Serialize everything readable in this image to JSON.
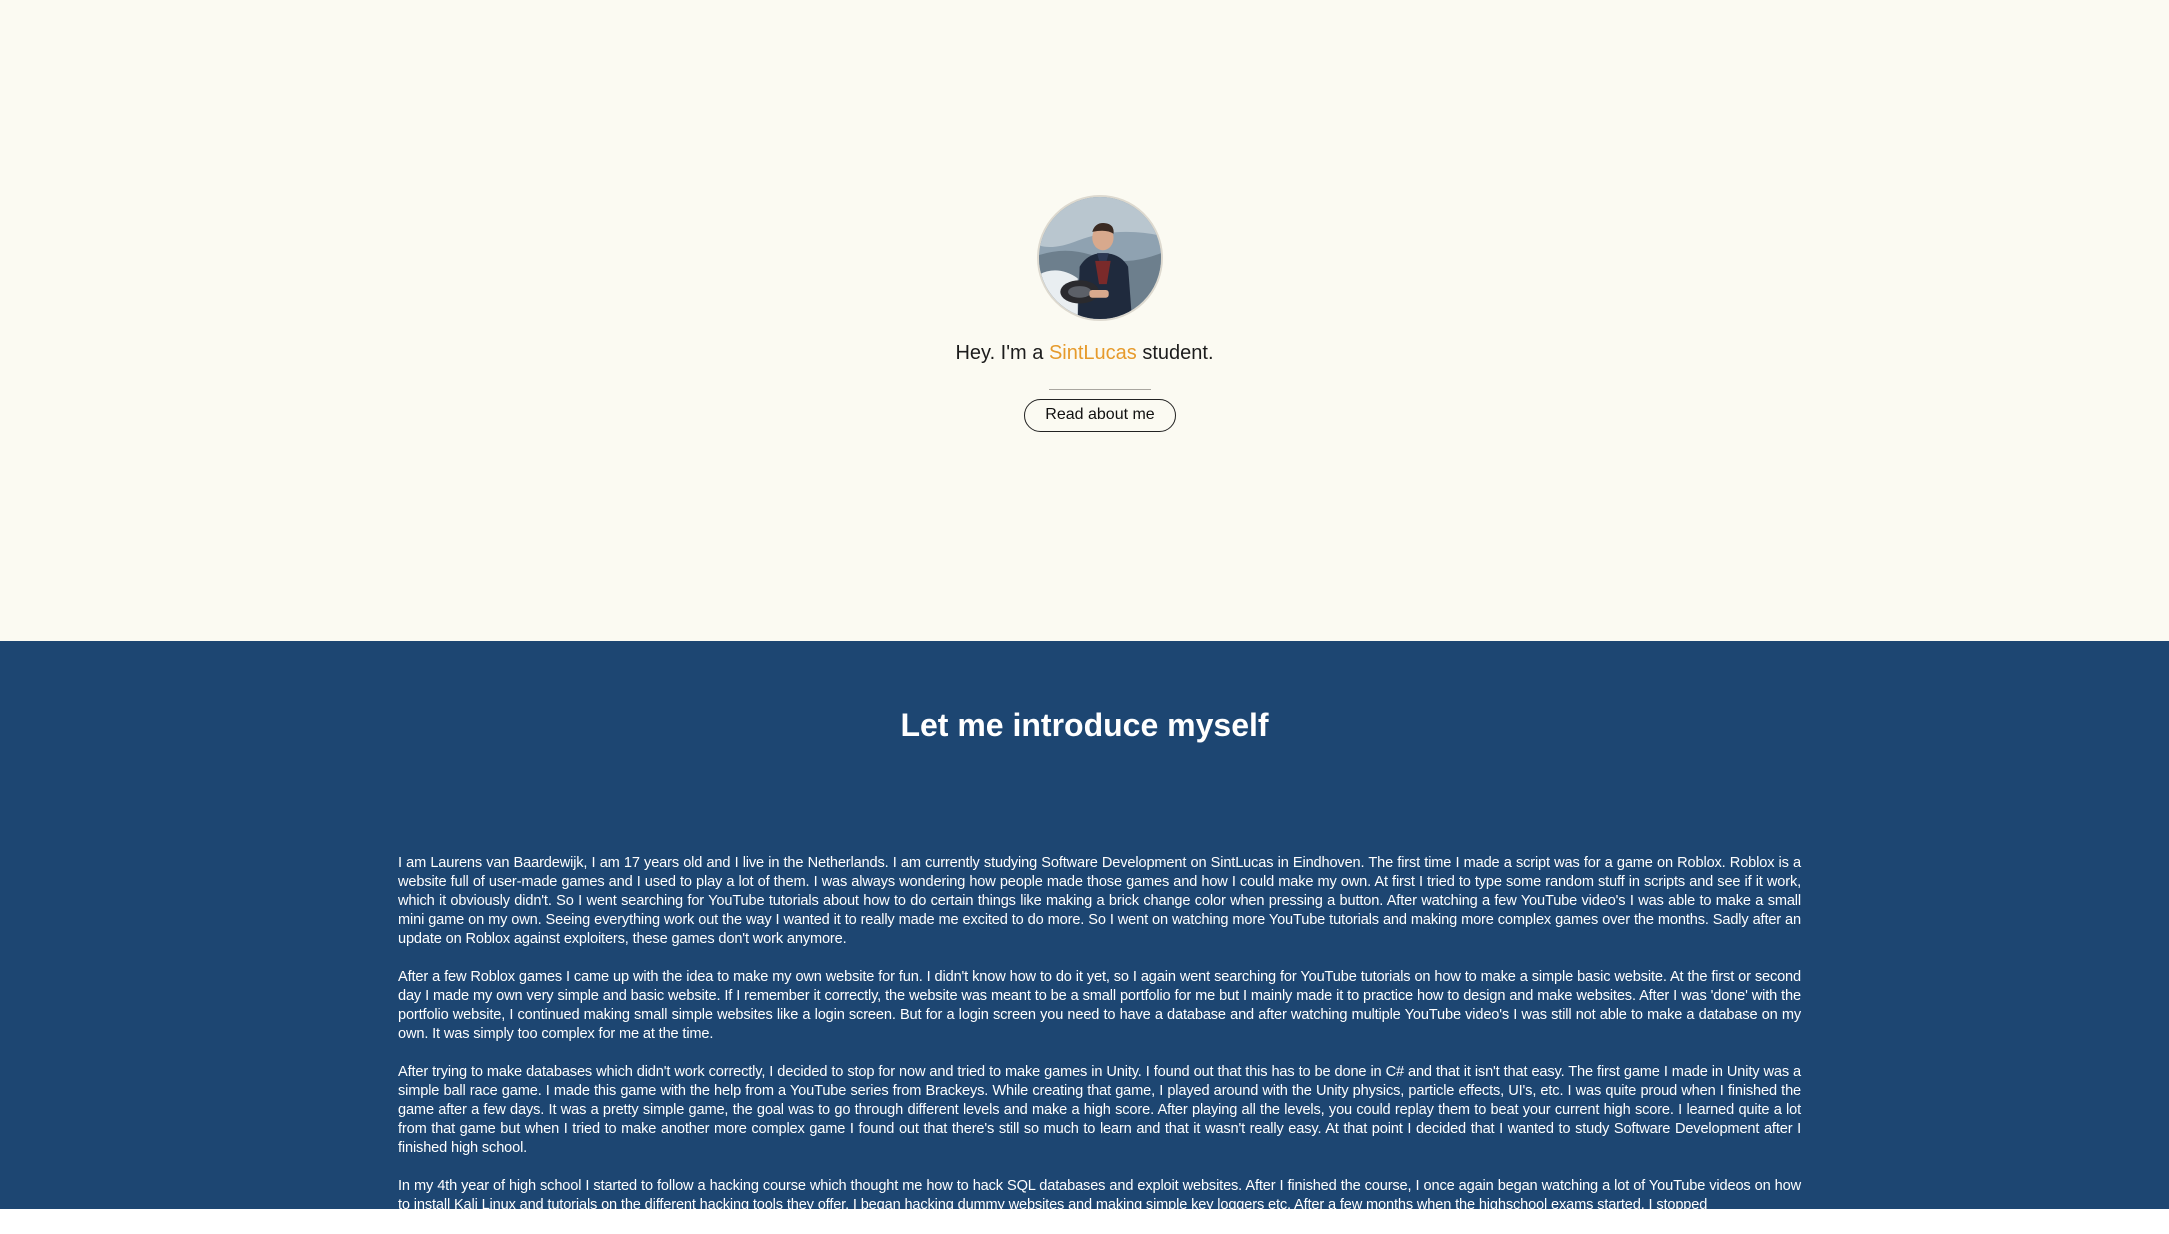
{
  "hero": {
    "tagline_prefix": "Hey. I'm a ",
    "tagline_highlight": "SintLucas",
    "tagline_suffix": " student.",
    "read_button_label": "Read about me",
    "highlight_color": "#e69a2b",
    "background_color": "#fbfaf2"
  },
  "intro": {
    "heading": "Let me introduce myself",
    "background_color": "#1d4672",
    "paragraphs": [
      "I am Laurens van Baardewijk, I am 17 years old and I live in the Netherlands. I am currently studying Software Development on SintLucas in Eindhoven. The first time I made a script was for a game on Roblox. Roblox is a website full of user-made games and I used to play a lot of them. I was always wondering how people made those games and how I could make my own. At first I tried to type some random stuff in scripts and see if it work, which it obviously didn't. So I went searching for YouTube tutorials about how to do certain things like making a brick change color when pressing a button. After watching a few YouTube video's I was able to make a small mini game on my own. Seeing everything work out the way I wanted it to really made me excited to do more. So I went on watching more YouTube tutorials and making more complex games over the months. Sadly after an update on Roblox against exploiters, these games don't work anymore.",
      "After a few Roblox games I came up with the idea to make my own website for fun. I didn't know how to do it yet, so I again went searching for YouTube tutorials on how to make a simple basic website. At the first or second day I made my own very simple and basic website. If I remember it correctly, the website was meant to be a small portfolio for me but I mainly made it to practice how to design and make websites. After I was 'done' with the portfolio website, I continued making small simple websites like a login screen. But for a login screen you need to have a database and after watching multiple YouTube video's I was still not able to make a database on my own. It was simply too complex for me at the time.",
      "After trying to make databases which didn't work correctly, I decided to stop for now and tried to make games in Unity. I found out that this has to be done in C# and that it isn't that easy. The first game I made in Unity was a simple ball race game. I made this game with the help from a YouTube series from Brackeys. While creating that game, I played around with the Unity physics, particle effects, UI's, etc. I was quite proud when I finished the game after a few days. It was a pretty simple game, the goal was to go through different levels and make a high score. After playing all the levels, you could replay them to beat your current high score. I learned quite a lot from that game but when I tried to make another more complex game I found out that there's still so much to learn and that it wasn't really easy. At that point I decided that I wanted to study Software Development after I finished high school.",
      "In my 4th year of high school I started to follow a hacking course which thought me how to hack SQL databases and exploit websites. After I finished the course, I once again began watching a lot of YouTube videos on how to install Kali Linux and tutorials on the different hacking tools they offer. I began hacking dummy websites and making simple key loggers etc. After a few months when the highschool exams started, I stopped"
    ]
  }
}
